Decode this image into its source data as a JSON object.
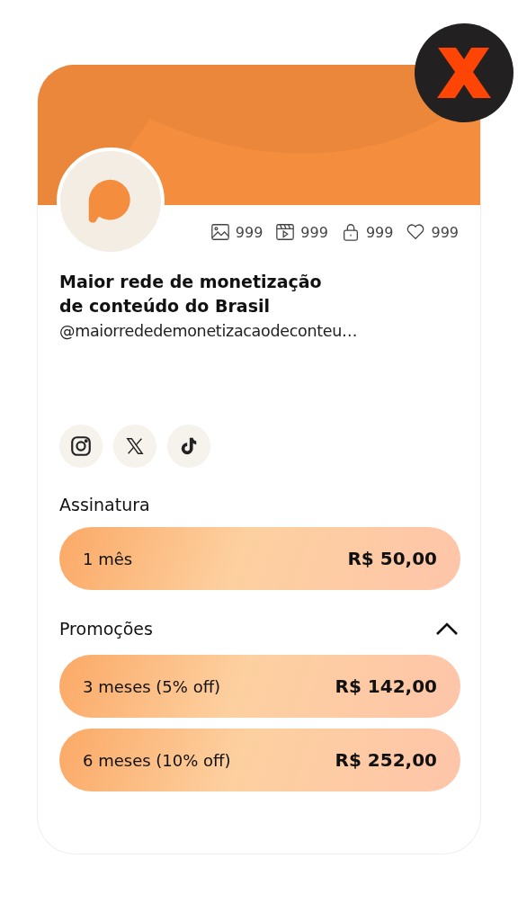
{
  "profile": {
    "title_lines": [
      "Maior rede de monetização",
      "de conteúdo do Brasil"
    ],
    "handle": "@maiorrededemonetizacaodeconteu…"
  },
  "stats": [
    {
      "kind": "images",
      "count": "999"
    },
    {
      "kind": "videos",
      "count": "999"
    },
    {
      "kind": "locked",
      "count": "999"
    },
    {
      "kind": "likes",
      "count": "999"
    }
  ],
  "socials": [
    {
      "kind": "instagram"
    },
    {
      "kind": "x"
    },
    {
      "kind": "tiktok"
    }
  ],
  "subscription": {
    "title": "Assinatura",
    "plans": [
      {
        "label": "1 mês",
        "price": "R$ 50,00"
      }
    ]
  },
  "promotions": {
    "title": "Promoções",
    "expanded": true,
    "plans": [
      {
        "label": "3 meses (5% off)",
        "price": "R$ 142,00"
      },
      {
        "label": "6 meses (10% off)",
        "price": "R$ 252,00"
      }
    ]
  }
}
